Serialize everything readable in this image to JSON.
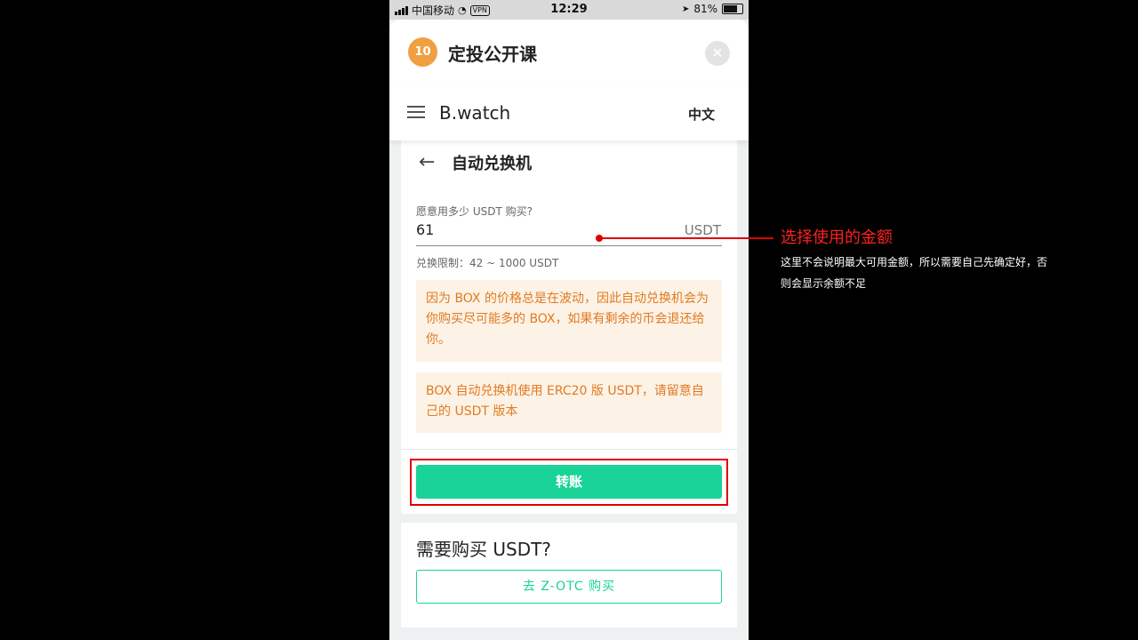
{
  "status_bar": {
    "carrier": "中国移动",
    "vpn": "VPN",
    "time": "12:29",
    "battery": "81%",
    "battery_level": 0.81
  },
  "app_header": {
    "title": "定投公开课",
    "logo_text": "10",
    "close_icon": "close-icon"
  },
  "navbar": {
    "brand": "B.watch",
    "language": "中文",
    "menu_icon": "hamburger-icon"
  },
  "exchange": {
    "back_icon": "arrow-left-icon",
    "title": "自动兑换机",
    "field_label": "愿意用多少 USDT 购买?",
    "amount_value": "61",
    "unit": "USDT",
    "limit": "兑换限制：42 ~ 1000 USDT",
    "notice_1": "因为 BOX 的价格总是在波动，因此自动兑换机会为你购买尽可能多的 BOX，如果有剩余的币会退还给你。",
    "notice_2": "BOX 自动兑换机使用 ERC20 版 USDT，请留意自己的 USDT 版本",
    "transfer_button": "转账"
  },
  "buy_section": {
    "title": "需要购买 USDT?",
    "otc_button": "去 Z-OTC 购买"
  },
  "annotation": {
    "title": "选择使用的金额",
    "description": "这里不会说明最大可用金额，所以需要自己先确定好，否则会显示余额不足"
  },
  "colors": {
    "accent": "#19d496",
    "notice_bg": "#fdf2e6",
    "notice_text": "#e07b21",
    "annotation_red": "#e00000"
  }
}
